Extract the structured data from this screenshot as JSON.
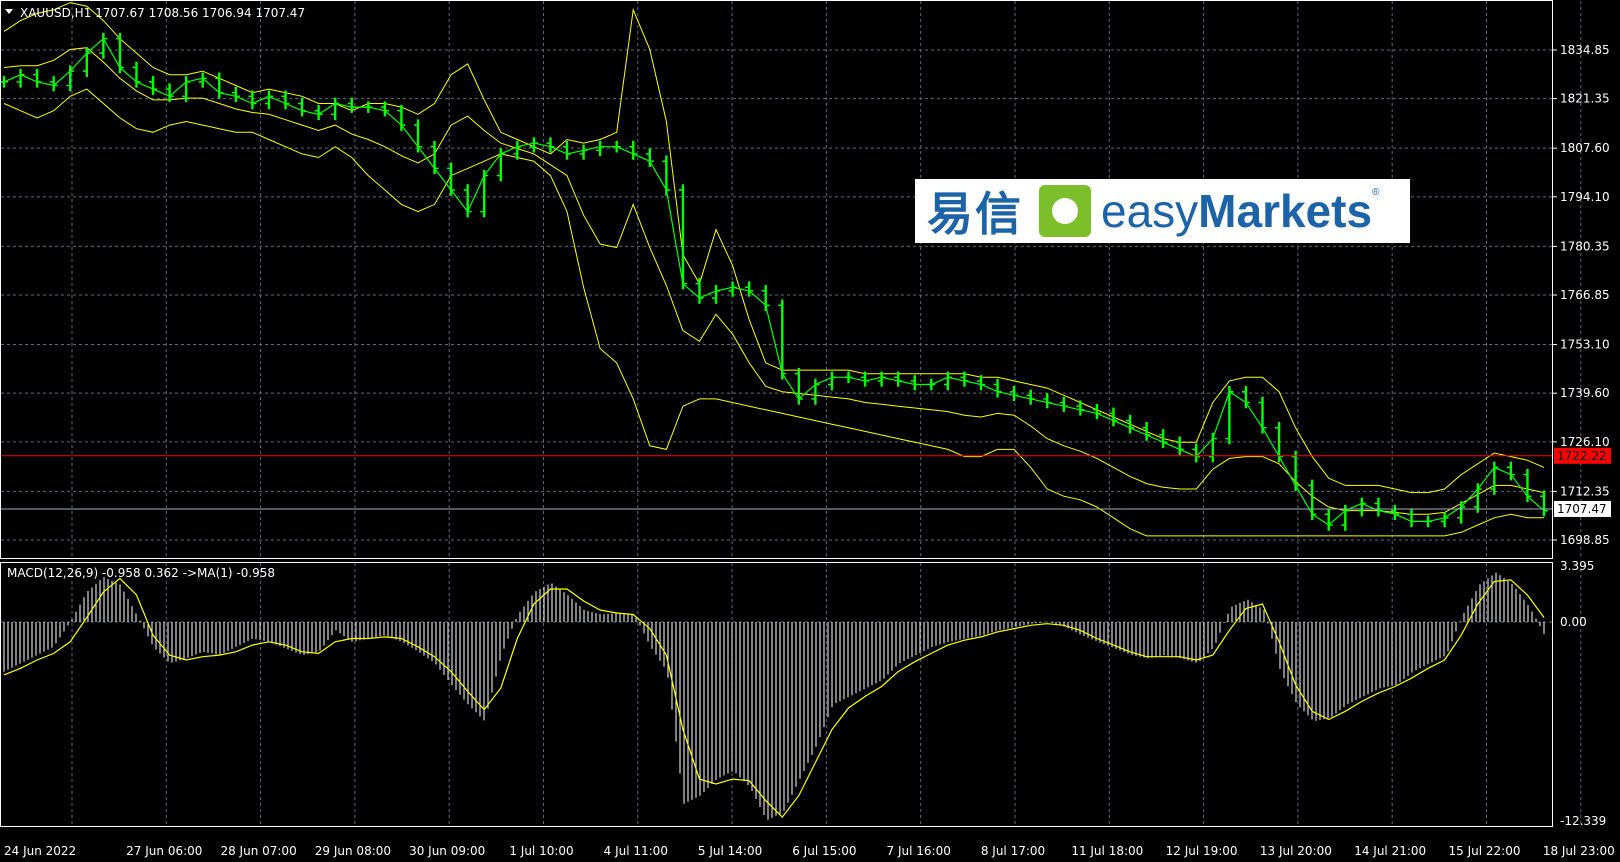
{
  "symbol_info": "XAUUSD,H1  1707.67 1708.56 1706.94 1707.47",
  "macd_info": "MACD(12,26,9) -0.958 0.362  ->MA(1) -0.958",
  "logo": {
    "chinese": "易信",
    "english_light": "easy",
    "english_bold": "Markets",
    "reg": "®"
  },
  "colors": {
    "background": "#000000",
    "candles": "#00ff00",
    "bands": "#ffff00",
    "grid": "#5a6a7a",
    "level_line": "#ff0000",
    "price_line": "#a0b0c0",
    "macd_hist": "#ffffff",
    "signal": "#ffff00"
  },
  "chart_data": [
    {
      "type": "line",
      "panel": "price",
      "y_ticks": [
        "1834.85",
        "1821.35",
        "1807.60",
        "1794.10",
        "1780.35",
        "1766.85",
        "1753.10",
        "1739.60",
        "1726.10",
        "1712.35",
        "1698.85"
      ],
      "ylim": [
        1693.5,
        1849.5
      ],
      "x_ticks": [
        "24 Jun 2022",
        "27 Jun 06:00",
        "28 Jun 07:00",
        "29 Jun 08:00",
        "30 Jun 09:00",
        "1 Jul 10:00",
        "4 Jul 11:00",
        "5 Jul 14:00",
        "6 Jul 15:00",
        "7 Jul 16:00",
        "8 Jul 17:00",
        "11 Jul 18:00",
        "12 Jul 19:00",
        "13 Jul 20:00",
        "14 Jul 21:00",
        "15 Jul 22:00",
        "18 Jul 23:00"
      ],
      "level_line": {
        "value": 1722.22,
        "label": "1722.22"
      },
      "last_price": {
        "value": 1707.47,
        "label": "1707.47"
      },
      "close": [
        1826,
        1828,
        1826,
        1825,
        1829,
        1834,
        1838,
        1830,
        1826,
        1824,
        1822,
        1826,
        1827,
        1823,
        1822,
        1820,
        1822,
        1820,
        1818,
        1817,
        1820,
        1819,
        1819,
        1818,
        1814,
        1808,
        1802,
        1796,
        1790,
        1800,
        1806,
        1808,
        1809,
        1808,
        1806,
        1807,
        1808,
        1808,
        1806,
        1804,
        1796,
        1770,
        1766,
        1768,
        1769,
        1768,
        1764,
        1745,
        1738,
        1742,
        1744,
        1744,
        1743,
        1744,
        1743,
        1742,
        1742,
        1744,
        1743,
        1742,
        1740,
        1739,
        1738,
        1737,
        1736,
        1735,
        1734,
        1732,
        1730,
        1728,
        1726,
        1724,
        1722,
        1727,
        1740,
        1737,
        1730,
        1722,
        1714,
        1706,
        1703,
        1707,
        1709,
        1707,
        1706,
        1704,
        1704,
        1705,
        1708,
        1713,
        1719,
        1717,
        1711,
        1707
      ],
      "upper_band": [
        1840,
        1843,
        1845,
        1846,
        1848,
        1847,
        1843,
        1838,
        1834,
        1830,
        1828,
        1828,
        1829,
        1827,
        1825,
        1823,
        1824,
        1823,
        1822,
        1820,
        1820,
        1818,
        1820,
        1820,
        1819,
        1817,
        1820,
        1828,
        1831,
        1821,
        1812,
        1810,
        1808,
        1806,
        1810,
        1809,
        1810,
        1812,
        1846,
        1835,
        1815,
        1778,
        1770,
        1785,
        1775,
        1760,
        1748,
        1746,
        1746,
        1746,
        1746,
        1746,
        1745,
        1745,
        1745,
        1745,
        1745,
        1745,
        1745,
        1744,
        1744,
        1743,
        1742,
        1741,
        1739,
        1737,
        1735,
        1733,
        1731,
        1729,
        1727,
        1726,
        1726,
        1737,
        1743,
        1744,
        1744,
        1740,
        1730,
        1722,
        1716,
        1714,
        1714,
        1714,
        1713,
        1712,
        1712,
        1713,
        1717,
        1720,
        1723,
        1722,
        1721,
        1719
      ],
      "lower_band": [
        1820,
        1818,
        1816,
        1818,
        1822,
        1824,
        1820,
        1816,
        1813,
        1812,
        1814,
        1815,
        1814,
        1813,
        1812,
        1812,
        1810,
        1808,
        1806,
        1805,
        1808,
        1805,
        1800,
        1796,
        1792,
        1790,
        1792,
        1800,
        1802,
        1804,
        1806,
        1805,
        1804,
        1800,
        1790,
        1769,
        1752,
        1748,
        1738,
        1725,
        1724,
        1736,
        1738,
        1738,
        1737,
        1736,
        1735,
        1734,
        1733,
        1732,
        1731,
        1730,
        1729,
        1728,
        1727,
        1726,
        1725,
        1724,
        1722,
        1722,
        1724,
        1724,
        1719,
        1713,
        1711,
        1710,
        1708,
        1705,
        1702,
        1700,
        1700,
        1700,
        1700,
        1700,
        1700,
        1700,
        1700,
        1700,
        1700,
        1700,
        1700,
        1700,
        1700,
        1700,
        1700,
        1700,
        1700,
        1700,
        1701,
        1703,
        1705,
        1706,
        1705,
        1705
      ]
    },
    {
      "type": "bar",
      "panel": "macd",
      "y_ticks": [
        "3.395",
        "0.00",
        "-12.339"
      ],
      "ylim": [
        -12.339,
        3.395
      ],
      "histogram": [
        -3.0,
        -2.5,
        -2.0,
        -1.5,
        0,
        2.0,
        3.0,
        2.5,
        0.5,
        -1.5,
        -2.5,
        -2.2,
        -1.8,
        -2.0,
        -1.5,
        -1.0,
        -1.2,
        -1.6,
        -2.0,
        -1.8,
        -0.5,
        -1.2,
        -1.0,
        -0.8,
        -1.2,
        -1.8,
        -2.5,
        -3.8,
        -5.0,
        -6.0,
        -2.0,
        0.5,
        2.0,
        2.6,
        1.8,
        0.8,
        0.5,
        0.6,
        0.5,
        -1.5,
        -3.0,
        -11.0,
        -10.5,
        -9.5,
        -9.0,
        -10.0,
        -12.0,
        -11.5,
        -9.5,
        -7.5,
        -5.0,
        -4.5,
        -4.0,
        -3.5,
        -2.5,
        -2.0,
        -1.5,
        -1.2,
        -1.0,
        -0.8,
        -0.5,
        -0.3,
        -0.1,
        0,
        -0.3,
        -0.8,
        -1.2,
        -1.6,
        -2.0,
        -2.2,
        -2.0,
        -2.2,
        -2.5,
        -1.5,
        1.0,
        1.5,
        0.8,
        -3.0,
        -5.0,
        -6.0,
        -5.8,
        -5.0,
        -4.5,
        -4.0,
        -3.8,
        -3.0,
        -2.5,
        -2.0,
        0.5,
        2.5,
        3.3,
        2.5,
        1.0,
        -0.958
      ],
      "signal": [
        -3.2,
        -2.8,
        -2.3,
        -1.9,
        -1.2,
        0.3,
        2.0,
        2.9,
        1.8,
        -0.8,
        -2.0,
        -2.3,
        -2.1,
        -2.0,
        -1.8,
        -1.4,
        -1.2,
        -1.4,
        -1.8,
        -1.9,
        -1.2,
        -1.0,
        -1.0,
        -0.9,
        -1.0,
        -1.5,
        -2.1,
        -3.0,
        -4.2,
        -5.3,
        -4.0,
        -1.0,
        1.2,
        2.2,
        2.2,
        1.4,
        0.8,
        0.6,
        0.5,
        -0.4,
        -2.0,
        -6.5,
        -9.5,
        -9.8,
        -9.5,
        -9.6,
        -10.8,
        -11.8,
        -10.5,
        -8.5,
        -6.5,
        -5.2,
        -4.5,
        -3.9,
        -3.0,
        -2.4,
        -1.9,
        -1.4,
        -1.1,
        -0.9,
        -0.6,
        -0.4,
        -0.2,
        -0.1,
        -0.2,
        -0.5,
        -1.0,
        -1.4,
        -1.8,
        -2.1,
        -2.1,
        -2.1,
        -2.3,
        -2.0,
        -0.5,
        0.9,
        1.2,
        -1.2,
        -3.8,
        -5.4,
        -5.9,
        -5.4,
        -4.8,
        -4.3,
        -3.9,
        -3.4,
        -2.8,
        -2.3,
        -0.8,
        1.2,
        2.7,
        2.8,
        1.8,
        0.3
      ]
    }
  ]
}
